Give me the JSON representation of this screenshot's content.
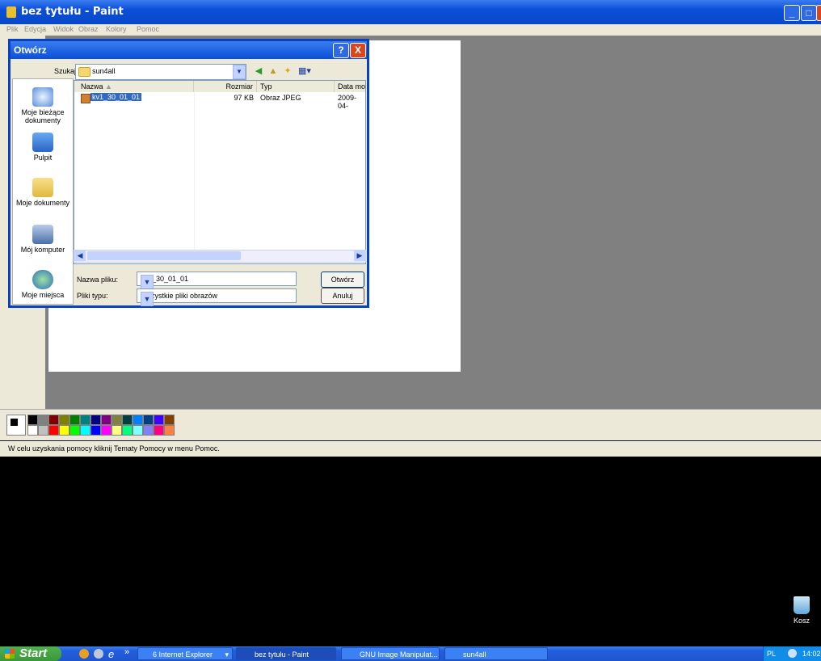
{
  "paint": {
    "title": "bez tytułu - Paint",
    "menu": [
      "Plik",
      "Edycja",
      "Widok",
      "Obraz",
      "Kolory",
      "Pomoc"
    ],
    "status": "W celu uzyskania pomocy kliknij Tematy Pomocy w menu Pomoc.",
    "palette_top": [
      "#000000",
      "#808080",
      "#800000",
      "#808000",
      "#008000",
      "#008080",
      "#000080",
      "#800080",
      "#808040",
      "#004040",
      "#0080ff",
      "#004080",
      "#4000ff",
      "#804000"
    ],
    "palette_bottom": [
      "#ffffff",
      "#c0c0c0",
      "#ff0000",
      "#ffff00",
      "#00ff00",
      "#00ffff",
      "#0000ff",
      "#ff00ff",
      "#ffff80",
      "#00ff80",
      "#80ffff",
      "#8080ff",
      "#ff0080",
      "#ff8040"
    ]
  },
  "dialog": {
    "title": "Otwórz",
    "help_label": "?",
    "close_label": "X",
    "look_in_label": "Szukaj w:",
    "look_in_value": "sun4all",
    "places": [
      "Moje bieżące dokumenty",
      "Pulpit",
      "Moje dokumenty",
      "Mój komputer",
      "Moje miejsca"
    ],
    "columns": [
      "Nazwa",
      "Rozmiar",
      "Typ",
      "Data mo"
    ],
    "files": [
      {
        "name": "kv1_30_01_01",
        "size": "97 KB",
        "type": "Obraz JPEG",
        "date": "2009-04-"
      }
    ],
    "filename_label": "Nazwa pliku:",
    "filename_value": "kv1_30_01_01",
    "filetype_label": "Pliki typu:",
    "filetype_value": "Wszystkie pliki obrazów",
    "open_button": "Otwórz",
    "cancel_button": "Anuluj"
  },
  "desktop": {
    "recycle_label": "Kosz"
  },
  "taskbar": {
    "start": "Start",
    "chevron": "»",
    "tasks": [
      "6 Internet Explorer",
      "bez tytułu - Paint",
      "GNU Image Manipulat...",
      "sun4all"
    ],
    "lang": "PL",
    "clock": "14:02"
  }
}
